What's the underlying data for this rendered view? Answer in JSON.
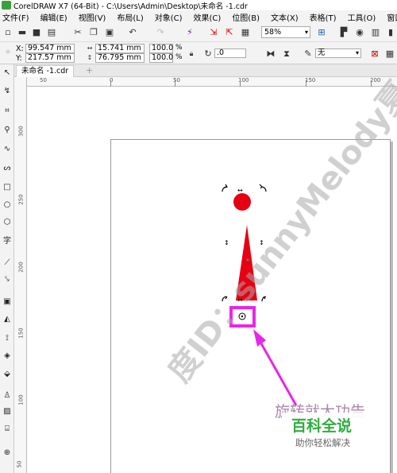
{
  "window": {
    "title": "CorelDRAW X7 (64-Bit) - C:\\Users\\Admin\\Desktop\\未命名 -1.cdr"
  },
  "menu": [
    "文件(F)",
    "编辑(E)",
    "视图(V)",
    "布局(L)",
    "对象(C)",
    "效果(C)",
    "位图(B)",
    "文本(X)",
    "表格(T)",
    "工具(O)",
    "窗口(W)"
  ],
  "toolbar": {
    "zoom": "58%"
  },
  "properties": {
    "x_label": "X:",
    "x_value": "99.547 mm",
    "y_label": "Y:",
    "y_value": "217.57 mm",
    "w_value": "15.741 mm",
    "h_value": "76.795 mm",
    "scale_w": "100.0",
    "scale_h": "100.0",
    "percent": "%",
    "rotation": ".0",
    "outline": "无"
  },
  "document_tab": {
    "label": "未命名 -1.cdr",
    "add": "+"
  },
  "ruler": {
    "h_marks": [
      "50",
      "0",
      "50",
      "100",
      "150",
      "200"
    ],
    "v_marks": [
      "300",
      "250",
      "200",
      "150",
      "100",
      "50"
    ]
  },
  "overlay": {
    "watermark": "度ID：sunnyMelody夏",
    "annotation": "旋转就大功告",
    "brand_main": "百科全说",
    "brand_sub": "助你轻松解决"
  },
  "colors": {
    "shape_fill": "#e60012",
    "highlight": "#e826e8",
    "brand": "#2fae3c"
  }
}
